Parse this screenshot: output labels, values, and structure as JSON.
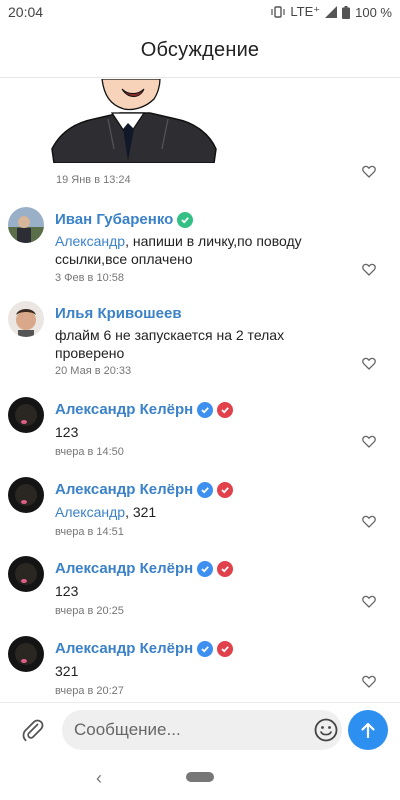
{
  "status": {
    "time": "20:04",
    "network": "LTE⁺",
    "battery": "100 %"
  },
  "header": {
    "title": "Обсуждение"
  },
  "sticker": {
    "time": "19 Янв в 13:24",
    "icon": "cartoon-man-sticker"
  },
  "comments": [
    {
      "author": "Иван Губаренко",
      "reply_to": "Александр",
      "text": ", напиши в личку,по поводу ссылки,все оплачено",
      "time": "3 Фев в 10:58",
      "badges": [
        "verified-green"
      ]
    },
    {
      "author": "Илья Кривошеев",
      "reply_to": "",
      "text": "флайм 6 не запускается  на 2 телах проверено",
      "time": "20 Мая в 20:33",
      "badges": []
    },
    {
      "author": "Александр Келёрн",
      "reply_to": "",
      "text": "123",
      "time": "вчера в 14:50",
      "badges": [
        "verified-blue",
        "verified-red"
      ]
    },
    {
      "author": "Александр Келёрн",
      "reply_to": "Александр",
      "text": ", 321",
      "time": "вчера в 14:51",
      "badges": [
        "verified-blue",
        "verified-red"
      ]
    },
    {
      "author": "Александр Келёрн",
      "reply_to": "",
      "text": "123",
      "time": "вчера в 20:25",
      "badges": [
        "verified-blue",
        "verified-red"
      ]
    },
    {
      "author": "Александр Келёрн",
      "reply_to": "",
      "text": "321",
      "time": "вчера в 20:27",
      "badges": [
        "verified-blue",
        "verified-red"
      ]
    }
  ],
  "composer": {
    "placeholder": "Сообщение..."
  },
  "nav": {
    "back": "‹"
  },
  "colors": {
    "accent": "#3b82c8",
    "send": "#2d8ff0",
    "green_badge": "#34c084",
    "blue_badge": "#3d8ff0",
    "red_badge": "#e0414b"
  }
}
